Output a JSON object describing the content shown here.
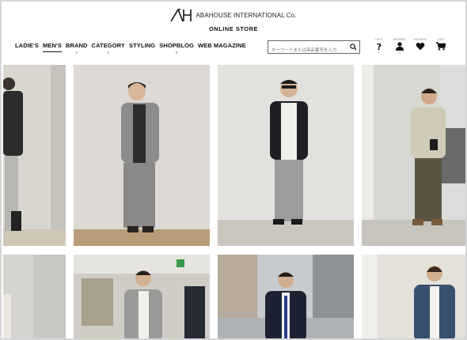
{
  "header": {
    "brand_name": "ABAHOUSE INTERNATIONAL Co.",
    "subtitle": "ONLINE STORE"
  },
  "nav": {
    "items": [
      {
        "label": "LADIE'S",
        "active": false,
        "caret": false
      },
      {
        "label": "MEN'S",
        "active": true,
        "caret": false
      },
      {
        "label": "BRAND",
        "active": false,
        "caret": true
      },
      {
        "label": "CATEGORY",
        "active": false,
        "caret": true
      },
      {
        "label": "STYLING",
        "active": false,
        "caret": false
      },
      {
        "label": "SHOPBLOG",
        "active": false,
        "caret": true
      },
      {
        "label": "WEB MAGAZINE",
        "active": false,
        "caret": false
      }
    ]
  },
  "search": {
    "placeholder": "キーワードまたは商品番号を入力"
  },
  "header_icons": [
    {
      "name": "help-icon",
      "label": "HELP"
    },
    {
      "name": "member-icon",
      "label": "MEMBER"
    },
    {
      "name": "favorite-icon",
      "label": "FAVORITE"
    },
    {
      "name": "cart-icon",
      "label": "CART"
    }
  ],
  "colors": {
    "accent": "#111111",
    "border": "#666666",
    "background": "#ffffff"
  }
}
